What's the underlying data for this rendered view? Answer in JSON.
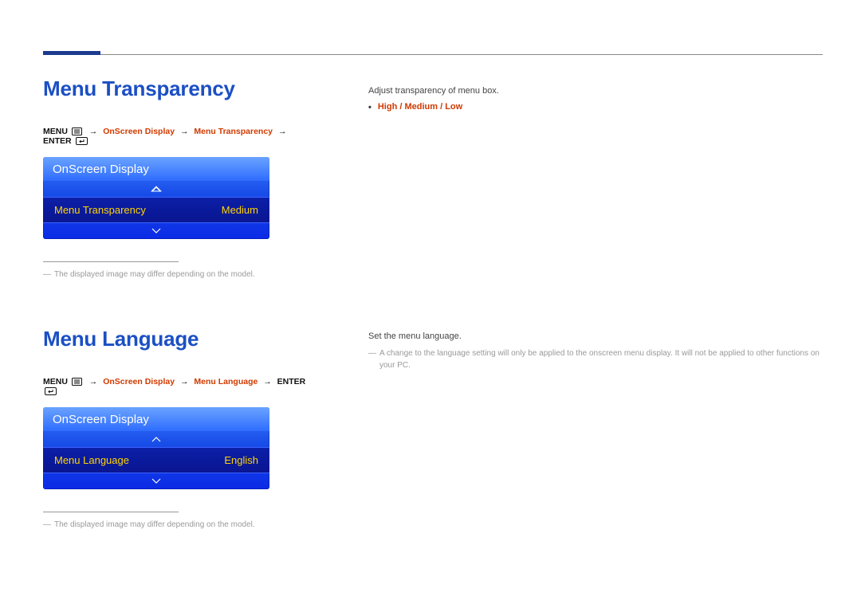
{
  "section1": {
    "title": "Menu Transparency",
    "breadcrumb": {
      "menu": "MENU",
      "p1": "OnScreen Display",
      "p2": "Menu Transparency",
      "enter": "ENTER"
    },
    "osd": {
      "header": "OnScreen Display",
      "item_label": "Menu Transparency",
      "item_value": "Medium"
    },
    "footnote": "The displayed image may differ depending on the model.",
    "right": {
      "desc": "Adjust transparency of menu box.",
      "options": "High / Medium / Low"
    }
  },
  "section2": {
    "title": "Menu Language",
    "breadcrumb": {
      "menu": "MENU",
      "p1": "OnScreen Display",
      "p2": "Menu Language",
      "enter": "ENTER"
    },
    "osd": {
      "header": "OnScreen Display",
      "item_label": "Menu Language",
      "item_value": "English"
    },
    "footnote": "The displayed image may differ depending on the model.",
    "right": {
      "desc": "Set the menu language.",
      "note": "A change to the language setting will only be applied to the onscreen menu display. It will not be applied to other functions on your PC."
    }
  }
}
